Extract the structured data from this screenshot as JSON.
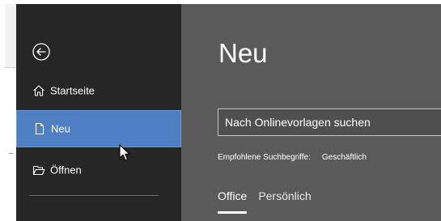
{
  "nav": {
    "items": [
      {
        "label": "Startseite",
        "icon": "home-icon"
      },
      {
        "label": "Neu",
        "icon": "new-document-icon",
        "selected": true
      },
      {
        "label": "Öffnen",
        "icon": "open-folder-icon"
      }
    ]
  },
  "main": {
    "title": "Neu",
    "search": {
      "placeholder": "Nach Onlinevorlagen suchen"
    },
    "suggested": {
      "label": "Empfohlene Suchbegriffe:",
      "terms": [
        "Geschäftlich"
      ]
    },
    "tabs": [
      {
        "label": "Office",
        "active": true
      },
      {
        "label": "Persönlich",
        "active": false
      }
    ]
  },
  "colors": {
    "nav_bg": "#262626",
    "selected_bg": "#4d7fc2",
    "main_bg": "#5a5a5a"
  }
}
